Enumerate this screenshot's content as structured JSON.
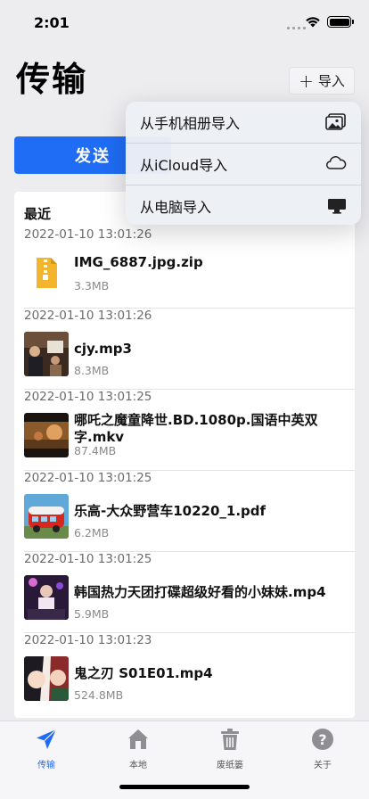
{
  "status_bar": {
    "time": "2:01"
  },
  "header": {
    "title": "传输",
    "import_label": "导入"
  },
  "tabs_top": {
    "send_label": "发送"
  },
  "dropdown": {
    "items": [
      {
        "label": "从手机相册导入",
        "icon": "photo-library-icon"
      },
      {
        "label": "从iCloud导入",
        "icon": "cloud-icon"
      },
      {
        "label": "从电脑导入",
        "icon": "desktop-icon"
      }
    ]
  },
  "recent": {
    "title": "最近",
    "files": [
      {
        "date": "2022-01-10 13:01:26",
        "name": "IMG_6887.jpg.zip",
        "size": "3.3MB",
        "thumb": "zip-file-icon"
      },
      {
        "date": "2022-01-10 13:01:26",
        "name": "cjy.mp3",
        "size": "8.3MB",
        "thumb": "concert-photo"
      },
      {
        "date": "2022-01-10 13:01:25",
        "name": "哪吒之魔童降世.BD.1080p.国语中英双字.mkv",
        "size": "87.4MB",
        "thumb": "movie-thumbnail"
      },
      {
        "date": "2022-01-10 13:01:25",
        "name": "乐高-大众野营车10220_1.pdf",
        "size": "6.2MB",
        "thumb": "red-van-photo"
      },
      {
        "date": "2022-01-10 13:01:25",
        "name": "韩国热力天团打碟超级好看的小妹妹.mp4",
        "size": "5.9MB",
        "thumb": "dj-performance-photo"
      },
      {
        "date": "2022-01-10 13:01:23",
        "name": "鬼之刃 S01E01.mp4",
        "size": "524.8MB",
        "thumb": "anime-thumbnail"
      }
    ]
  },
  "tab_bar": {
    "items": [
      {
        "label": "传输",
        "icon": "paper-plane-icon",
        "active": true
      },
      {
        "label": "本地",
        "icon": "home-icon",
        "active": false
      },
      {
        "label": "废纸篓",
        "icon": "trash-icon",
        "active": false
      },
      {
        "label": "关于",
        "icon": "question-icon",
        "active": false
      }
    ]
  },
  "colors": {
    "accent": "#1f6cf5",
    "background": "#ededf0"
  }
}
